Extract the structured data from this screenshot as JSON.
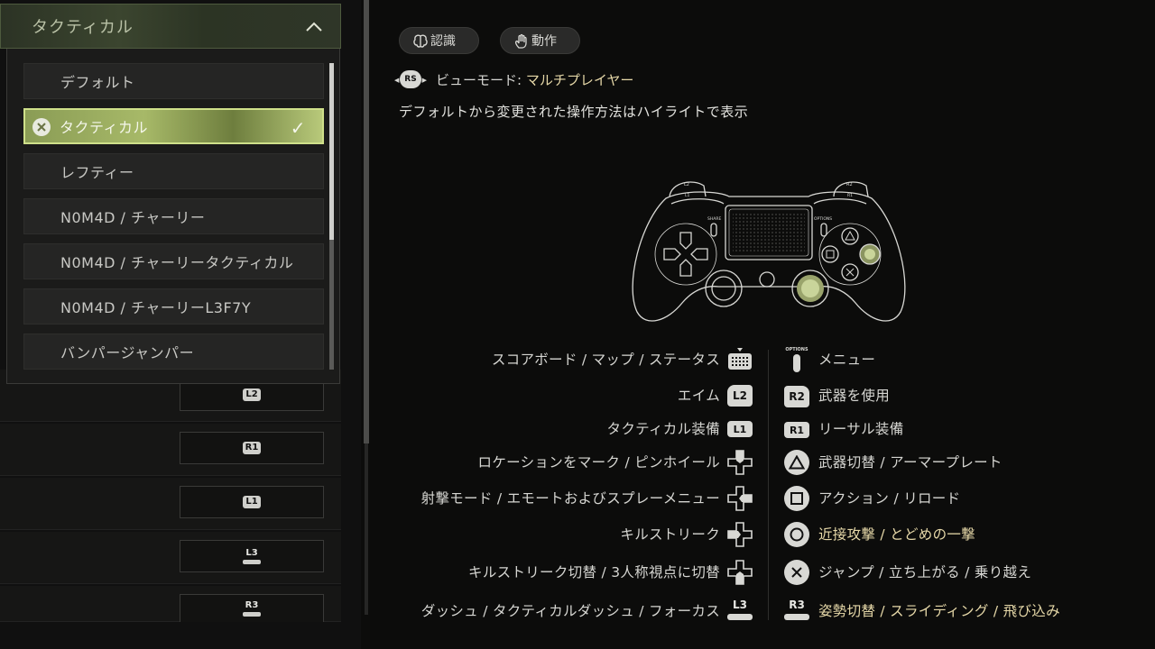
{
  "left_panel": {
    "dropdown": {
      "title": "タクティカル",
      "options": [
        {
          "label": "デフォルト",
          "selected": false
        },
        {
          "label": "タクティカル",
          "selected": true
        },
        {
          "label": "レフティー",
          "selected": false
        },
        {
          "label": "N0M4D / チャーリー",
          "selected": false
        },
        {
          "label": "N0M4D / チャーリータクティカル",
          "selected": false
        },
        {
          "label": "N0M4D / チャーリーL3F7Y",
          "selected": false
        },
        {
          "label": "バンパージャンパー",
          "selected": false
        }
      ],
      "selected_icon": "cross-icon",
      "check_icon": "checkmark-icon",
      "expand_icon": "chevron-up-icon"
    },
    "background_keys": [
      {
        "label": "L2"
      },
      {
        "label": "R1"
      },
      {
        "label": "L1"
      },
      {
        "label": "L3"
      },
      {
        "label": "R3"
      }
    ]
  },
  "tabs": [
    {
      "label": "認識",
      "icon": "brain-icon"
    },
    {
      "label": "動作",
      "icon": "hand-icon"
    }
  ],
  "view_mode": {
    "button": "RS",
    "label": "ビューモード:",
    "value": "マルチプレイヤー"
  },
  "highlight_note": "デフォルトから変更された操作方法はハイライトで表示",
  "controller_labels": {
    "share": "SHARE",
    "options": "OPTIONS",
    "l1": "L1",
    "l2": "L2",
    "r1": "R1",
    "r2": "R2"
  },
  "left_bindings": [
    {
      "label": "スコアボード / マップ / ステータス",
      "button": "touchpad-icon"
    },
    {
      "label": "エイム",
      "button": "L2"
    },
    {
      "label": "タクティカル装備",
      "button": "L1"
    },
    {
      "label": "ロケーションをマーク / ピンホイール",
      "button": "dpad-up-icon"
    },
    {
      "label": "射撃モード / エモートおよびスプレーメニュー",
      "button": "dpad-right-icon"
    },
    {
      "label": "キルストリーク",
      "button": "dpad-left-icon"
    },
    {
      "label": "キルストリーク切替 / 3人称視点に切替",
      "button": "dpad-down-icon"
    },
    {
      "label": "ダッシュ / タクティカルダッシュ / フォーカス",
      "button": "L3"
    }
  ],
  "right_bindings": [
    {
      "label": "メニュー",
      "button": "OPTIONS",
      "highlighted": false
    },
    {
      "label": "武器を使用",
      "button": "R2",
      "highlighted": false
    },
    {
      "label": "リーサル装備",
      "button": "R1",
      "highlighted": false
    },
    {
      "label": "武器切替 / アーマープレート",
      "button": "triangle-icon",
      "highlighted": false
    },
    {
      "label": "アクション / リロード",
      "button": "square-icon",
      "highlighted": false
    },
    {
      "label": "近接攻撃 / とどめの一撃",
      "button": "circle-icon",
      "highlighted": true
    },
    {
      "label": "ジャンプ / 立ち上がる / 乗り越え",
      "button": "cross-icon",
      "highlighted": false
    },
    {
      "label": "姿勢切替 / スライディング / 飛び込み",
      "button": "R3",
      "highlighted": true
    }
  ],
  "colors": {
    "accent_highlight": "#e6d8a8",
    "selected_option": "#a7b968",
    "highlighted_control": "#c9d49a"
  }
}
